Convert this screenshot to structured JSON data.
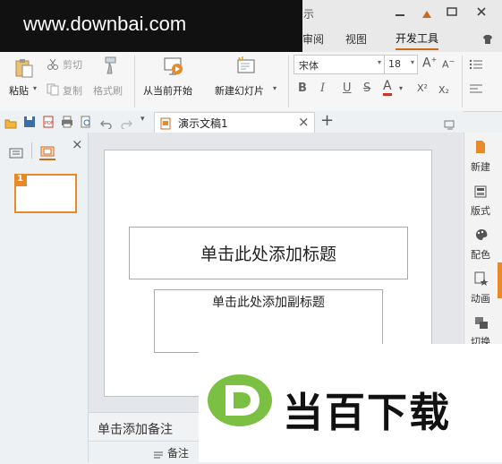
{
  "watermark": {
    "text": "www.downbai.com"
  },
  "titlebar": {
    "app_title_fragment": "示"
  },
  "tabs": [
    {
      "label": "审阅"
    },
    {
      "label": "视图"
    },
    {
      "label": "开发工具"
    }
  ],
  "ribbon": {
    "cut": "剪切",
    "paste": "粘贴",
    "copy": "复制",
    "format_painter": "格式刷",
    "from_current": "从当前开始",
    "new_slide": "新建幻灯片",
    "font_name": "宋体",
    "font_size": "18",
    "bold": "B",
    "italic": "I",
    "underline": "U",
    "strike": "S",
    "font_color": "A",
    "superscript": "X²",
    "subscript": "X₂"
  },
  "document_tab": {
    "label": "演示文稿1",
    "close": "×",
    "add": "+"
  },
  "left_panel": {
    "close": "×",
    "slide_number": "1"
  },
  "slide": {
    "title_placeholder": "单击此处添加标题",
    "subtitle_placeholder": "单击此处添加副标题"
  },
  "notes": {
    "placeholder": "单击添加备注"
  },
  "status": {
    "notes_toggle": "备注"
  },
  "right_panel": [
    {
      "label": "新建"
    },
    {
      "label": "版式"
    },
    {
      "label": "配色"
    },
    {
      "label": "动画"
    },
    {
      "label": "切换"
    }
  ],
  "logo": {
    "text": "当百下载",
    "badge_letter": "D"
  },
  "colors": {
    "accent": "#c76b1d",
    "logo_green": "#7bc043"
  }
}
